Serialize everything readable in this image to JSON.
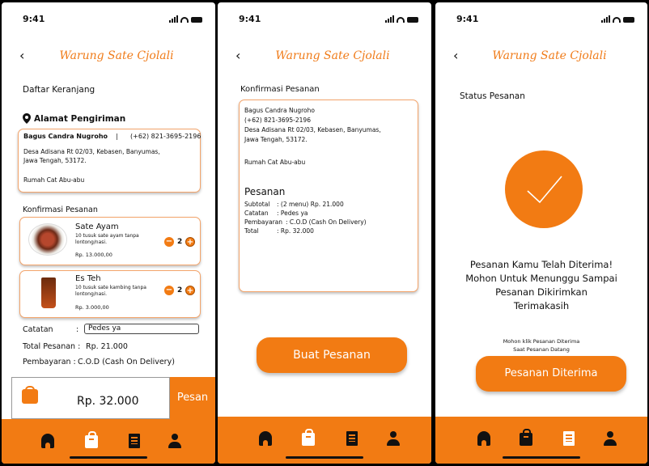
{
  "status_time": "9:41",
  "brand": "Warung Sate Cjolali",
  "back_glyph": "‹",
  "colors": {
    "accent": "#f27b13",
    "card_border": "#f3a46b"
  },
  "screen1": {
    "title": "Daftar Keranjang",
    "address_heading": "Alamat Pengiriman",
    "address": {
      "name": "Bagus Candra Nugroho",
      "separator": "|",
      "phone": "(+62) 821-3695-2196",
      "line1": "Desa Adisana Rt 02/03, Kebasen, Banyumas,",
      "line2": "Jawa Tengah, 53172.",
      "note": "Rumah Cat Abu-abu"
    },
    "confirm_heading": "Konfirmasi Pesanan",
    "items": [
      {
        "name": "Sate Ayam",
        "desc1": "10 tusuk sate ayam tanpa",
        "desc2": "lontong/nasi.",
        "price": "Rp. 13.000,00",
        "qty": "2",
        "minus": "−",
        "plus": "+"
      },
      {
        "name": "Es Teh",
        "desc1": "10 tusuk sate kambing tanpa",
        "desc2": "lontong/nasi.",
        "price": "Rp. 3.000,00",
        "qty": "2",
        "minus": "−",
        "plus": "+"
      }
    ],
    "note_label": "Catatan",
    "note_colon": ":",
    "note_value": "Pedes ya",
    "total_label": "Total Pesanan :",
    "total_value": "Rp. 21.000",
    "payment_label": "Pembayaran :",
    "payment_value": "C.O.D (Cash On Delivery)",
    "checkout_total": "Rp. 32.000",
    "checkout_button": "Pesan"
  },
  "screen2": {
    "title": "Konfirmasi Pesanan",
    "name": "Bagus Candra Nugroho",
    "phone": "(+62) 821-3695-2196",
    "line1": "Desa Adisana Rt 02/03, Kebasen, Banyumas,",
    "line2": "Jawa Tengah, 53172.",
    "note": "Rumah Cat Abu-abu",
    "order_heading": "Pesanan",
    "rows": [
      {
        "label": "Subtotal",
        "value": ": (2 menu) Rp. 21.000"
      },
      {
        "label": "Catatan",
        "value": ": Pedes ya"
      },
      {
        "label": "Pembayaran",
        "value": ": C.O.D (Cash On Delivery)"
      },
      {
        "label": "Total",
        "value": ": Rp. 32.000"
      }
    ],
    "button": "Buat Pesanan"
  },
  "screen3": {
    "title": "Status Pesanan",
    "message": [
      "Pesanan Kamu Telah Diterima!",
      "Mohon Untuk Menunggu Sampai",
      "Pesanan Dikirimkan",
      "Terimakasih"
    ],
    "hint": [
      "Mohon klik Pesanan Diterima",
      "Saat Pesanan Datang"
    ],
    "button": "Pesanan Diterima"
  },
  "icons": [
    "home-icon",
    "bag-icon",
    "order-list-icon",
    "profile-icon",
    "location-pin-icon",
    "check-icon"
  ]
}
